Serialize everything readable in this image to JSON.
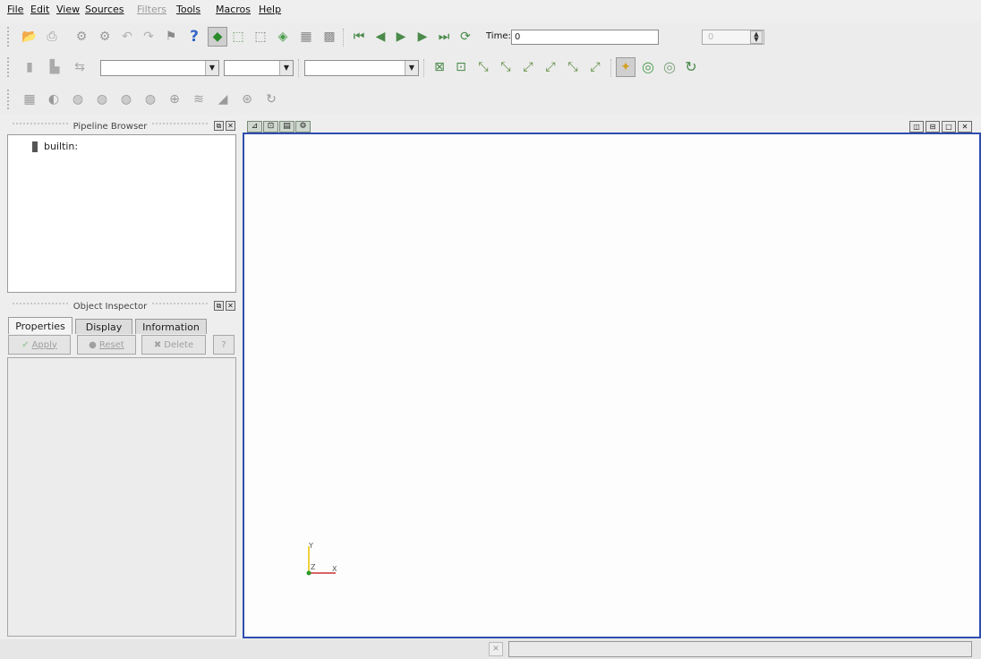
{
  "menu": {
    "items": [
      {
        "label": "File",
        "enabled": true
      },
      {
        "label": "Edit",
        "enabled": true
      },
      {
        "label": "View",
        "enabled": true
      },
      {
        "label": "Sources",
        "enabled": true
      },
      {
        "label": "Filters",
        "enabled": false
      },
      {
        "label": "Tools",
        "enabled": true
      },
      {
        "label": "Macros",
        "enabled": true
      },
      {
        "label": "Help",
        "enabled": true
      }
    ]
  },
  "time": {
    "label": "Time:",
    "value": "0",
    "spin_value": "0"
  },
  "pipeline": {
    "title": "Pipeline Browser",
    "root_item": "builtin:"
  },
  "inspector": {
    "title": "Object Inspector",
    "tabs": [
      {
        "label": "Properties",
        "active": true
      },
      {
        "label": "Display",
        "active": false
      },
      {
        "label": "Information",
        "active": false
      }
    ],
    "apply_label": "Apply",
    "reset_label": "Reset",
    "delete_label": "Delete",
    "help_label": "?"
  },
  "axes": {
    "y": "Y",
    "z": "Z",
    "x": "X"
  },
  "colors": {
    "viewport_border": "#2d4eb0",
    "axis_x": "#cc3333",
    "axis_y": "#e6c200",
    "axis_z": "#2a9a2a"
  }
}
